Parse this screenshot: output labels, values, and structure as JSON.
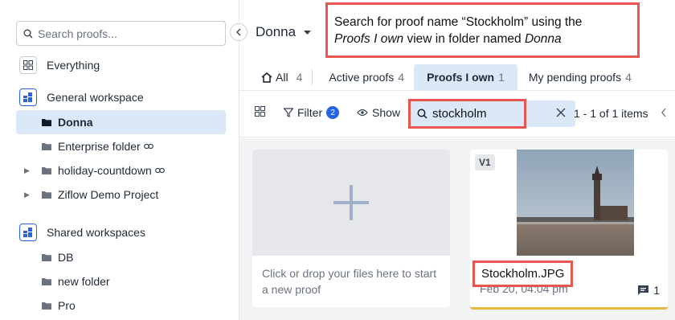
{
  "sidebar": {
    "search_placeholder": "Search proofs...",
    "everything_label": "Everything",
    "general_workspace_label": "General workspace",
    "general_items": [
      {
        "label": "Donna"
      },
      {
        "label": "Enterprise folder"
      },
      {
        "label": "holiday-countdown"
      },
      {
        "label": "Ziflow Demo Project"
      }
    ],
    "shared_workspaces_label": "Shared workspaces",
    "shared_items": [
      {
        "label": "DB"
      },
      {
        "label": "new folder"
      },
      {
        "label": "Pro"
      }
    ]
  },
  "header": {
    "folder_name": "Donna",
    "callout_line1": "Search for proof name “Stockholm” using the",
    "callout_italic1": "Proofs I own",
    "callout_mid": " view in folder named ",
    "callout_italic2": "Donna"
  },
  "tabs": [
    {
      "label": "All",
      "count": "4"
    },
    {
      "label": "Active proofs",
      "count": "4"
    },
    {
      "label": "Proofs I own",
      "count": "1"
    },
    {
      "label": "My pending proofs",
      "count": "4"
    }
  ],
  "toolbar": {
    "filter_label": "Filter",
    "filter_count": "2",
    "show_label": "Show",
    "search_value": "stockholm",
    "pager_text": "1 - 1 of 1 items"
  },
  "content": {
    "upload_text": "Click or drop your files here to start a new proof",
    "proof": {
      "version": "V1",
      "name": "Stockholm.JPG",
      "date": "Feb 20, 04:04 pm",
      "comment_count": "1"
    }
  },
  "colors": {
    "accent": "#2563eb",
    "selected_bg": "#dbe8f7",
    "annotation_red": "#e8574f",
    "status_yellow": "#e5b93b"
  }
}
